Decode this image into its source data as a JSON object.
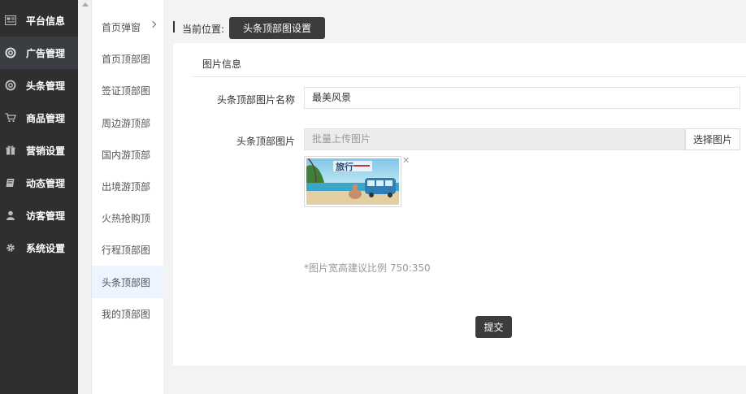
{
  "sidebar": {
    "items": [
      {
        "label": "平台信息",
        "icon": "newspaper-icon",
        "active": false
      },
      {
        "label": "广告管理",
        "icon": "lifebuoy-icon",
        "active": true
      },
      {
        "label": "头条管理",
        "icon": "lifebuoy-icon",
        "active": false
      },
      {
        "label": "商品管理",
        "icon": "cart-icon",
        "active": false
      },
      {
        "label": "营销设置",
        "icon": "gift-icon",
        "active": false
      },
      {
        "label": "动态管理",
        "icon": "book-icon",
        "active": false
      },
      {
        "label": "访客管理",
        "icon": "user-icon",
        "active": false
      },
      {
        "label": "系统设置",
        "icon": "gear-icon",
        "active": false
      }
    ]
  },
  "submenu": {
    "items": [
      {
        "label": "首页弹窗",
        "active": false
      },
      {
        "label": "首页顶部图",
        "active": false
      },
      {
        "label": "签证顶部图",
        "active": false
      },
      {
        "label": "周边游顶部",
        "active": false
      },
      {
        "label": "国内游顶部",
        "active": false
      },
      {
        "label": "出境游顶部",
        "active": false
      },
      {
        "label": "火热抢购顶",
        "active": false
      },
      {
        "label": "行程顶部图",
        "active": false
      },
      {
        "label": "头条顶部图",
        "active": true
      },
      {
        "label": "我的顶部图",
        "active": false
      }
    ]
  },
  "breadcrumb": {
    "label": "当前位置:",
    "current": "头条顶部图设置"
  },
  "panel": {
    "title": "图片信息"
  },
  "form": {
    "name_label": "头条顶部图片名称",
    "name_value": "最美风景",
    "image_label": "头条顶部图片",
    "upload_placeholder": "批量上传图片",
    "choose_button": "选择图片",
    "thumbnail_text": "旅行",
    "hint": "*图片宽高建议比例 750:350",
    "submit": "提交"
  },
  "colors": {
    "sidebar_bg": "#2f2f2f",
    "sidebar_active": "#3a3d42",
    "submenu_active": "#ebf4ff",
    "dark_button": "#3c3c3c",
    "page_bg": "#f3f3f4"
  }
}
